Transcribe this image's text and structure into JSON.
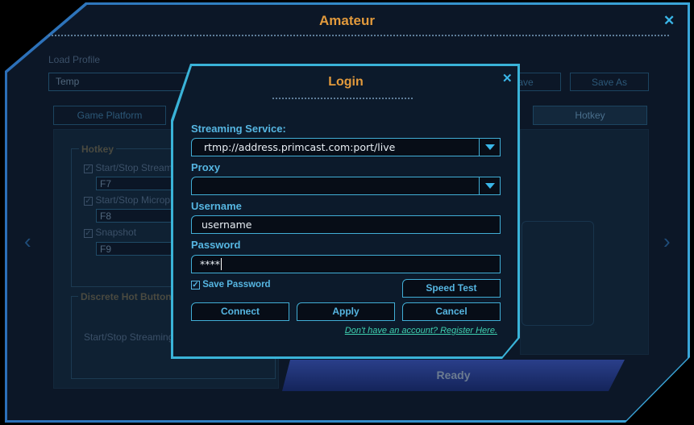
{
  "window": {
    "title": "Amateur",
    "close_icon": "close-icon"
  },
  "background": {
    "load_profile_label": "Load Profile",
    "profile_value": "Temp",
    "save_label": "Save",
    "save_as_label": "Save As",
    "tabs": [
      {
        "label": "Game Platform"
      },
      {
        "label": "Hotkey",
        "active": true
      }
    ],
    "hotkey_group": {
      "title": "Hotkey",
      "items": [
        {
          "label": "Start/Stop Streaming",
          "checked": true,
          "key": "F7"
        },
        {
          "label": "Start/Stop Microphone",
          "checked": true,
          "key": "F8"
        },
        {
          "label": "Snapshot",
          "checked": true,
          "key": "F9"
        }
      ]
    },
    "discrete_group": {
      "title": "Discrete Hot Button",
      "item": "Start/Stop Streaming"
    },
    "status": "Ready"
  },
  "login": {
    "title": "Login",
    "streaming_service_label": "Streaming Service:",
    "streaming_service_value": "rtmp://address.primcast.com:port/live",
    "proxy_label": "Proxy",
    "proxy_value": "",
    "username_label": "Username",
    "username_value": "username",
    "password_label": "Password",
    "password_value": "****",
    "save_password_label": "Save Password",
    "save_password_checked": true,
    "speed_test_label": "Speed Test",
    "connect_label": "Connect",
    "apply_label": "Apply",
    "cancel_label": "Cancel",
    "register_link": "Don't have an account? Register Here."
  },
  "colors": {
    "accent": "#3ab6e8",
    "title": "#e29a3c",
    "link": "#3fd0b0"
  }
}
